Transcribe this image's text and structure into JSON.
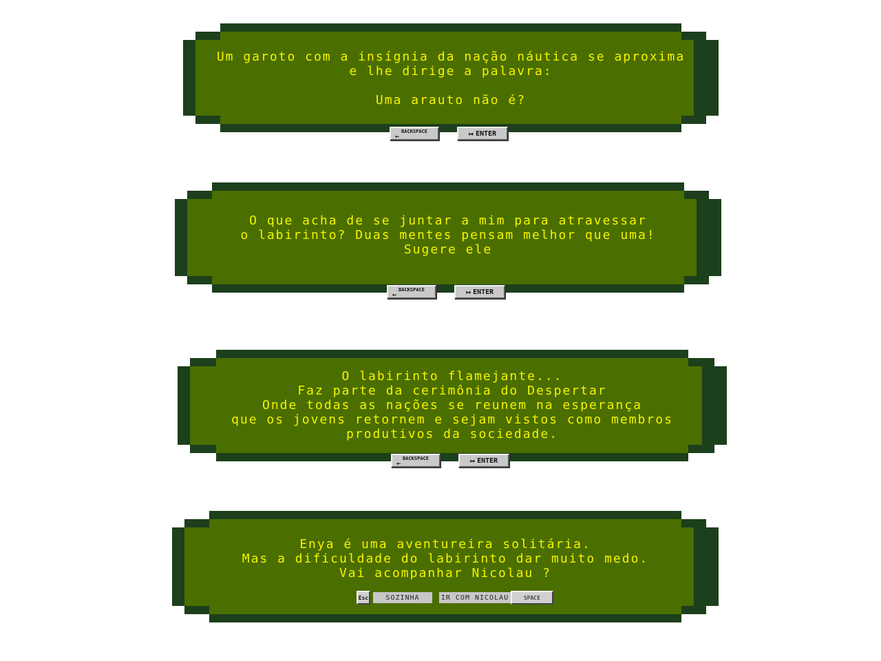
{
  "dialogs": [
    {
      "text": "Um garoto com a insígnia da nação náutica se aproxima\ne lhe dirige a palavra:\n\nUma arauto não é?",
      "backspace_label": "BACKSPACE",
      "enter_label": "ENTER"
    },
    {
      "text": "O que acha de se juntar a mim para atravessar\no labirinto? Duas mentes pensam melhor que uma!\nSugere ele",
      "backspace_label": "BACKSPACE",
      "enter_label": "ENTER"
    },
    {
      "text": "O labirinto flamejante...\nFaz parte da cerimônia do Despertar\nOnde todas as nações se reunem na esperança\nque os jovens retornem e sejam vistos como membros\nprodutivos da sociedade.",
      "backspace_label": "BACKSPACE",
      "enter_label": "ENTER"
    },
    {
      "text": "Enya é uma aventureira solitária.\nMas a dificuldade do labirinto dar muito medo.\nVai acompanhar Nicolau ?",
      "esc_label": "Esc",
      "option_alone": "SOZINHA",
      "option_with": "IR COM NICOLAU",
      "space_label": "SPACE"
    }
  ],
  "colors": {
    "panel_fill": "#4b6e00",
    "panel_border": "#1c3f1c",
    "text": "#f4f400",
    "key_face": "#c9c9c9"
  }
}
